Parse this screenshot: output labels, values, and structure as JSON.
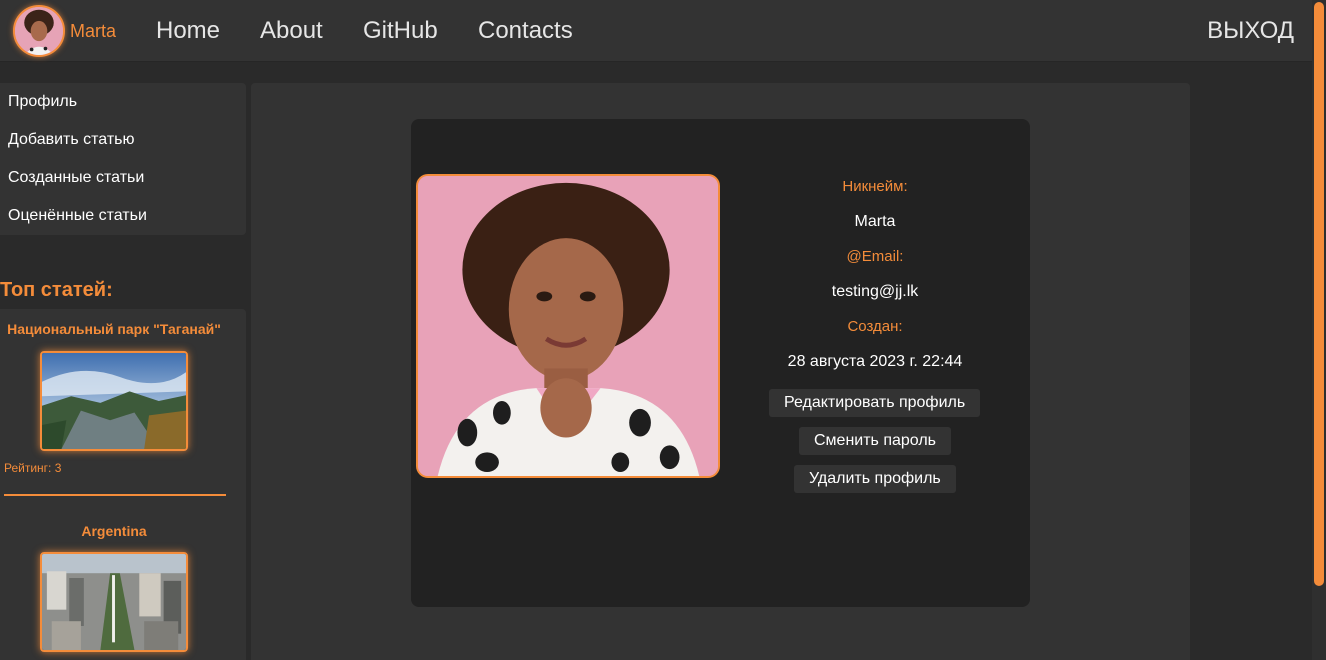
{
  "header": {
    "user_name": "Marta",
    "nav": [
      {
        "label": "Home"
      },
      {
        "label": "About"
      },
      {
        "label": "GitHub"
      },
      {
        "label": "Contacts"
      }
    ],
    "logout_label": "ВЫХОД"
  },
  "sidebar": {
    "menu": [
      {
        "label": "Профиль"
      },
      {
        "label": "Добавить статью"
      },
      {
        "label": "Созданные статьи"
      },
      {
        "label": "Оценённые статьи"
      }
    ],
    "top_heading": "Топ статей:",
    "top_articles": [
      {
        "title": "Национальный парк \"Таганай\"",
        "rating": "Рейтинг: 3"
      },
      {
        "title": "Argentina"
      }
    ]
  },
  "profile": {
    "nickname_label": "Никнейм:",
    "nickname": "Marta",
    "email_label": "@Email:",
    "email": "testing@jj.lk",
    "created_label": "Создан:",
    "created": "28 августа 2023 г. 22:44",
    "edit_button": "Редактировать профиль",
    "change_password_button": "Сменить пароль",
    "delete_button": "Удалить профиль"
  },
  "colors": {
    "accent": "#f48c3a",
    "header_bg": "#333333",
    "card_bg": "#222222",
    "page_bg": "#2a2a2a"
  }
}
